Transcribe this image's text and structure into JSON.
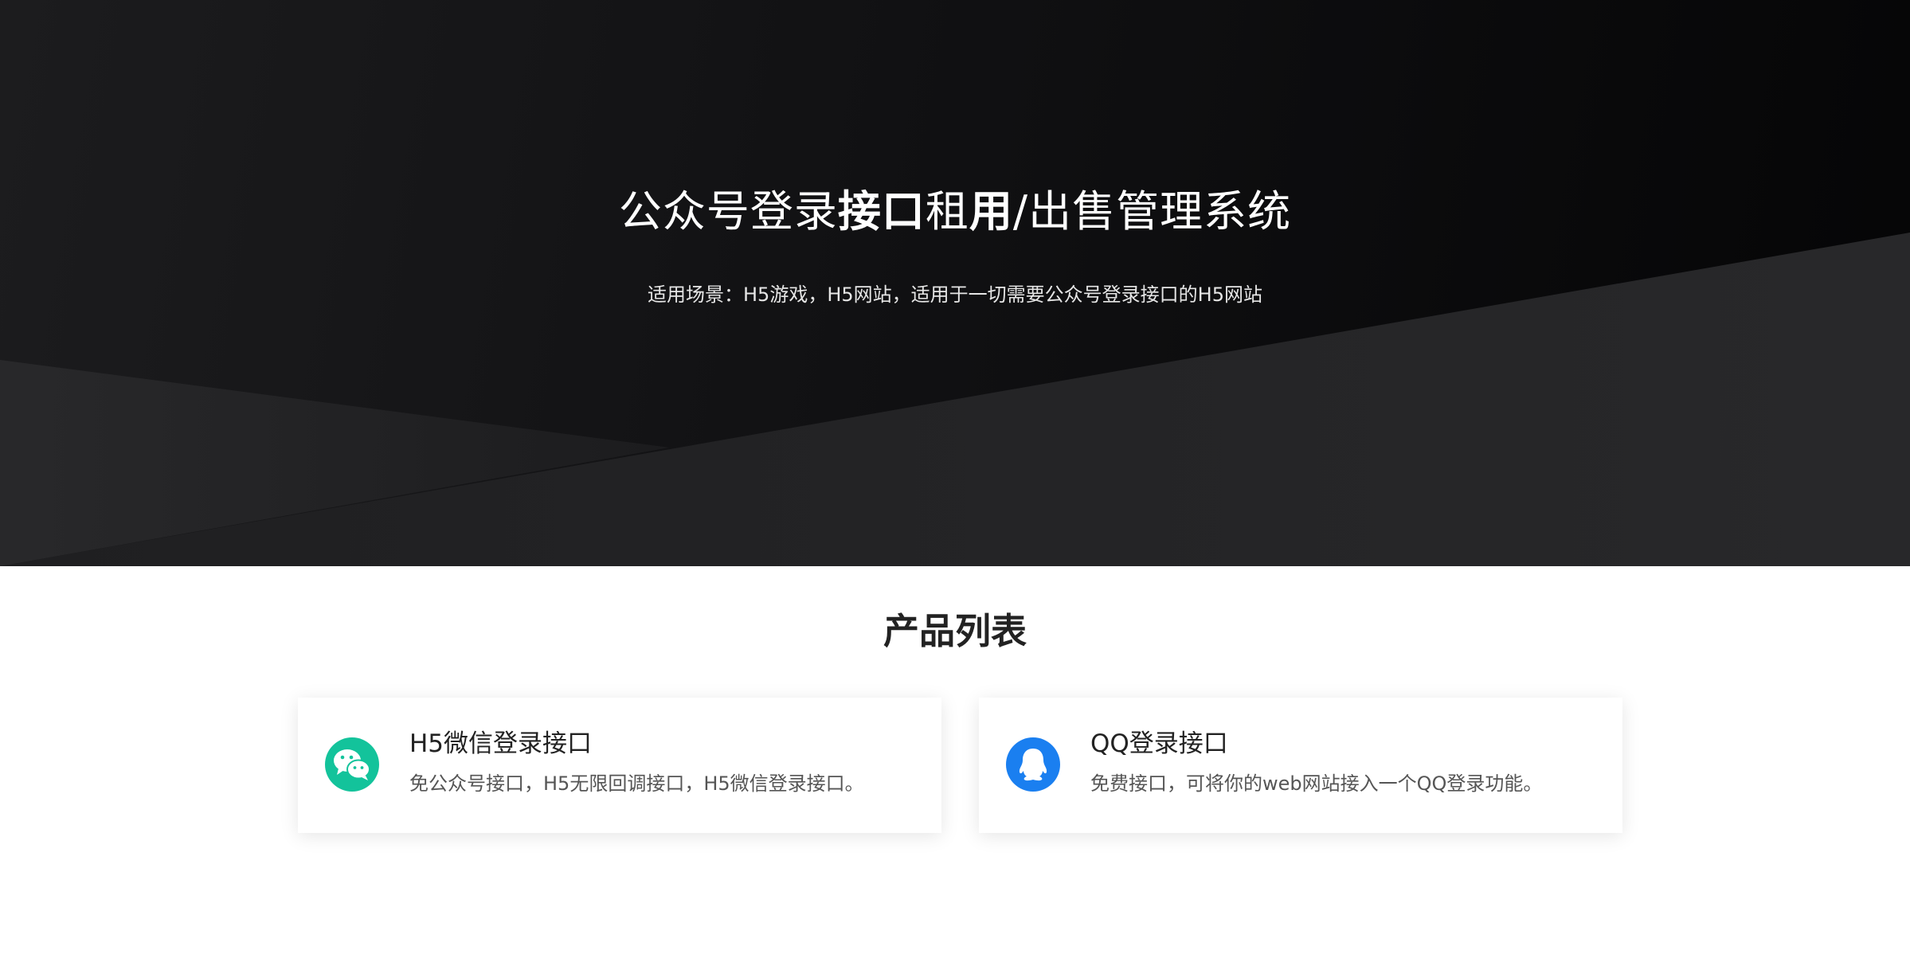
{
  "hero": {
    "title_part1": "公众号登录",
    "title_part2": "接口",
    "title_part3": "租",
    "title_part4": "用",
    "title_part5": "/出售管理系统",
    "subtitle": "适用场景：H5游戏，H5网站，适用于一切需要公众号登录接口的H5网站"
  },
  "products": {
    "heading": "产品列表",
    "items": [
      {
        "title": "H5微信登录接口",
        "description": "免公众号接口，H5无限回调接口，H5微信登录接口。",
        "icon": "wechat-icon",
        "color": "#13c39b"
      },
      {
        "title": "QQ登录接口",
        "description": "免费接口，可将你的web网站接入一个QQ登录功能。",
        "icon": "qq-icon",
        "color": "#1a7ff0"
      }
    ]
  }
}
